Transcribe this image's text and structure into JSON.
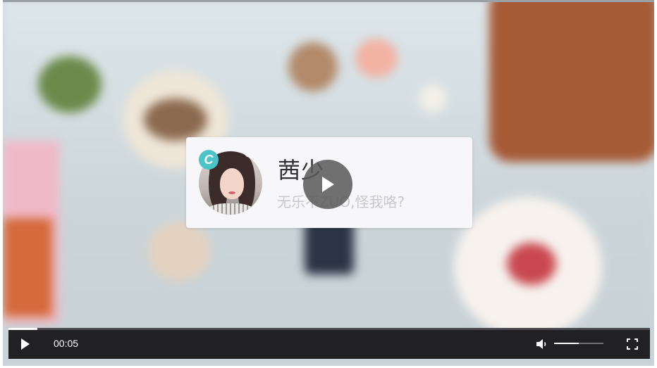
{
  "profile": {
    "badge_letter": "C",
    "name": "茜少",
    "bio": "无乐不ZUO,怪我咯?",
    "badge_color": "#4cc3c6"
  },
  "player": {
    "current_time": "00:05",
    "progress_fraction": 0.045,
    "volume_fraction": 0.5,
    "state": "paused"
  },
  "icons": {
    "big_play": "play-icon",
    "play": "play-icon",
    "volume": "volume-icon",
    "fullscreen": "fullscreen-icon",
    "avatar_badge": "badge-icon"
  }
}
